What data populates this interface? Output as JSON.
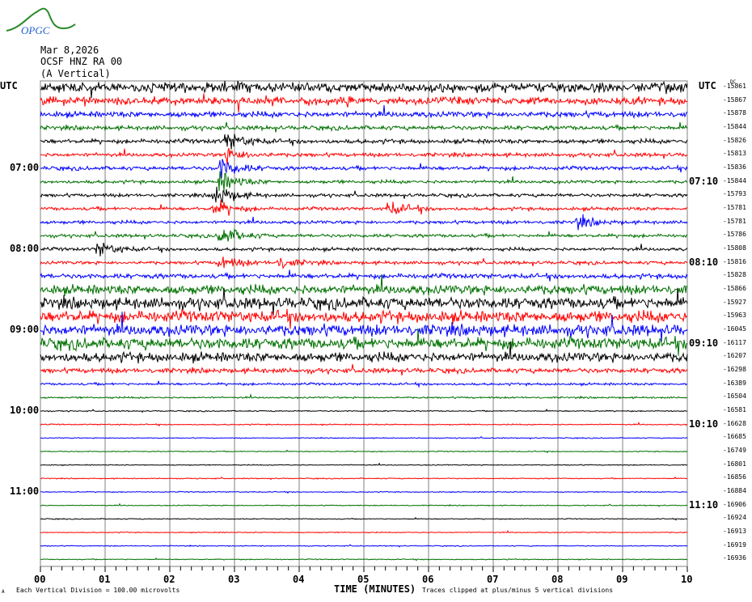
{
  "header": {
    "logo_text": "OPGC",
    "date": "Mar 8,2026",
    "station": "OCSF HNZ RA 00",
    "component": "(A Vertical)"
  },
  "left_axis": {
    "utc_label": "UTC",
    "hours": [
      "07:00",
      "08:00",
      "09:00",
      "10:00",
      "11:00"
    ]
  },
  "right_axis": {
    "utc_label": "UTC",
    "dc_label": "DC",
    "hours": [
      "07:10",
      "08:10",
      "09:10",
      "10:10",
      "11:10"
    ]
  },
  "footer": {
    "xlabel": "TIME (MINUTES)",
    "scale_note": "Each Vertical Division =  100.00 microvolts",
    "clip_note": "Traces clipped at plus/minus 5 vertical divisions",
    "corner_mark": "A"
  },
  "colors": {
    "trace_cycle": [
      "#000000",
      "#ff0000",
      "#0000ff",
      "#007000"
    ],
    "grid": "#808080"
  },
  "chart_data": {
    "type": "line",
    "title": "OCSF HNZ RA 00 helicorder",
    "xlabel": "TIME (MINUTES)",
    "xlim": [
      0,
      10
    ],
    "x_ticks": [
      "00",
      "01",
      "02",
      "03",
      "04",
      "05",
      "06",
      "07",
      "08",
      "09",
      "10"
    ],
    "rows_per_hour": 6,
    "dc_offsets": [
      -15861,
      -15867,
      -15878,
      -15844,
      -15826,
      -15813,
      -15836,
      -15844,
      -15793,
      -15781,
      -15781,
      -15786,
      -15808,
      -15816,
      -15828,
      -15866,
      -15927,
      -15963,
      -16045,
      -16117,
      -16207,
      -16298,
      -16389,
      -16504,
      -16581,
      -16628,
      -16685,
      -16749,
      -16801,
      -16856,
      -16884,
      -16906,
      -16924,
      -16913,
      -16919,
      -16936
    ],
    "relative_amplitude": [
      1.0,
      0.8,
      0.6,
      0.45,
      0.45,
      0.4,
      0.4,
      0.35,
      0.35,
      0.35,
      0.35,
      0.35,
      0.35,
      0.35,
      0.5,
      1.0,
      1.2,
      1.2,
      1.2,
      1.2,
      1.0,
      0.5,
      0.25,
      0.18,
      0.12,
      0.12,
      0.1,
      0.1,
      0.1,
      0.1,
      0.1,
      0.1,
      0.1,
      0.1,
      0.1,
      0.1
    ],
    "events": [
      {
        "row": 4,
        "minute": 2.9,
        "amp": 1.2
      },
      {
        "row": 5,
        "minute": 2.9,
        "amp": 1.0
      },
      {
        "row": 6,
        "minute": 2.8,
        "amp": 1.5
      },
      {
        "row": 7,
        "minute": 2.8,
        "amp": 1.4
      },
      {
        "row": 8,
        "minute": 2.7,
        "amp": 1.6
      },
      {
        "row": 9,
        "minute": 2.7,
        "amp": 1.2
      },
      {
        "row": 9,
        "minute": 5.4,
        "amp": 1.0
      },
      {
        "row": 10,
        "minute": 8.3,
        "amp": 0.8
      },
      {
        "row": 11,
        "minute": 2.8,
        "amp": 1.5
      },
      {
        "row": 12,
        "minute": 0.9,
        "amp": 1.0
      },
      {
        "row": 13,
        "minute": 2.8,
        "amp": 1.0
      },
      {
        "row": 13,
        "minute": 3.7,
        "amp": 0.8
      }
    ]
  }
}
